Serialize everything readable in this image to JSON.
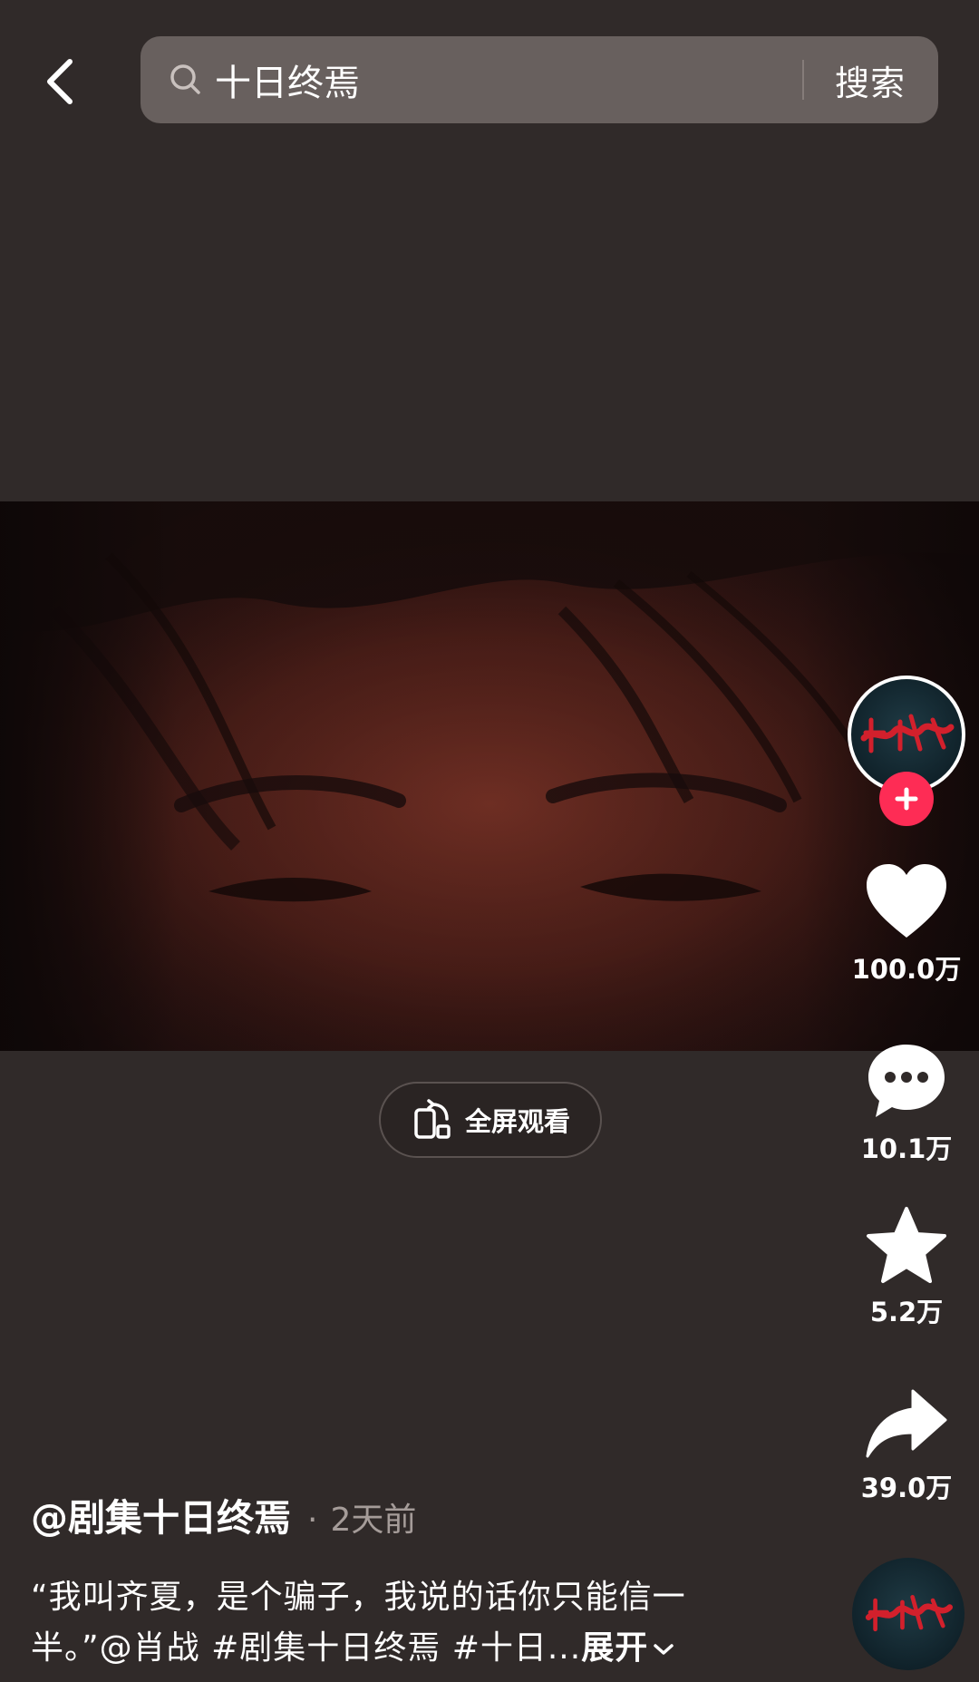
{
  "header": {
    "search_query": "十日终焉",
    "search_button": "搜索"
  },
  "player": {
    "fullscreen_label": "全屏观看"
  },
  "actions": {
    "likes": "100.0万",
    "comments": "10.1万",
    "favorites": "5.2万",
    "shares": "39.0万"
  },
  "author": {
    "name": "@剧集十日终焉",
    "separator": "·",
    "time": "2天前"
  },
  "caption": {
    "line1": "“我叫齐夏，是个骗子，我说的话你只能信一",
    "line2": "半。”@肖战 #剧集十日终焉 #十日...",
    "expand": "展开"
  },
  "colors": {
    "background": "#302a29",
    "search_bg": "#68605e",
    "follow_pink": "#fe2c55"
  },
  "icons": [
    "back-arrow-icon",
    "search-icon",
    "fullscreen-rotate-icon",
    "heart-icon",
    "comment-icon",
    "star-icon",
    "share-icon",
    "plus-icon",
    "chevron-down-icon"
  ]
}
